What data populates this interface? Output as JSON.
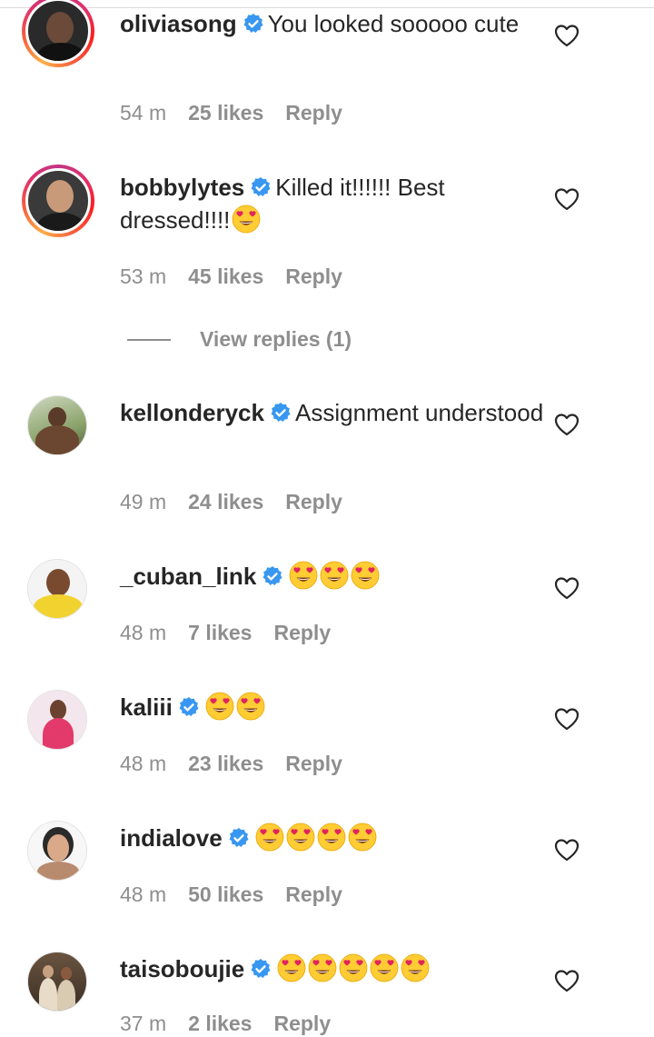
{
  "comments": [
    {
      "username": "oliviasong",
      "text": "You looked sooooo cute",
      "emoji_count": 0,
      "time": "54 m",
      "likes": "25 likes",
      "reply": "Reply",
      "avatar_icon": "user-avatar"
    },
    {
      "username": "bobbylytes",
      "text": "Killed it!!!!!! Best dressed!!!!",
      "emoji_count": 1,
      "time": "53 m",
      "likes": "45 likes",
      "reply": "Reply",
      "avatar_icon": "user-avatar"
    },
    {
      "username": "kellonderyck",
      "text": "Assignment understood",
      "emoji_count": 0,
      "time": "49 m",
      "likes": "24 likes",
      "reply": "Reply",
      "avatar_icon": "user-avatar"
    },
    {
      "username": "_cuban_link",
      "text": "",
      "emoji_count": 3,
      "time": "48 m",
      "likes": "7 likes",
      "reply": "Reply",
      "avatar_icon": "user-avatar"
    },
    {
      "username": "kaliii",
      "text": "",
      "emoji_count": 2,
      "time": "48 m",
      "likes": "23 likes",
      "reply": "Reply",
      "avatar_icon": "user-avatar"
    },
    {
      "username": "indialove",
      "text": "",
      "emoji_count": 4,
      "time": "48 m",
      "likes": "50 likes",
      "reply": "Reply",
      "avatar_icon": "user-avatar"
    },
    {
      "username": "taisoboujie",
      "text": "",
      "emoji_count": 5,
      "time": "37 m",
      "likes": "2 likes",
      "reply": "Reply",
      "avatar_icon": "user-avatar"
    }
  ],
  "view_replies": "View replies (1)",
  "icons": {
    "verified": "verified-badge-icon",
    "heart": "heart-outline-icon",
    "emoji": "heart-eyes-emoji"
  },
  "colors": {
    "verified": "#3897f0",
    "muted": "#8e8e8e",
    "text": "#262626",
    "emoji_face": "#ffcc33",
    "emoji_heart": "#e0245e"
  }
}
